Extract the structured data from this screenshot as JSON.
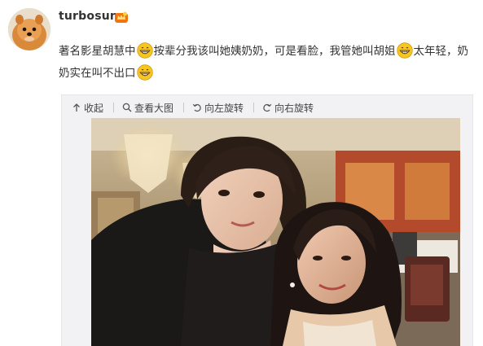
{
  "post": {
    "username": "turbosun",
    "text_segments": [
      {
        "type": "text",
        "value": "著名影星胡慧中"
      },
      {
        "type": "emoji",
        "icon": "grin-emoji-icon"
      },
      {
        "type": "text",
        "value": "按辈分我该叫她姨奶奶，可是看脸，我管她叫胡姐"
      },
      {
        "type": "emoji",
        "icon": "grin-emoji-icon"
      },
      {
        "type": "text",
        "value": "太年轻，奶奶实在叫不出口"
      },
      {
        "type": "emoji",
        "icon": "grin-emoji-icon"
      }
    ]
  },
  "media_toolbar": {
    "collapse": "收起",
    "view_large": "查看大图",
    "rotate_left": "向左旋转",
    "rotate_right": "向右旋转"
  },
  "icons": {
    "avatar": "pomeranian-dog-avatar",
    "vip": "vip-crown-badge-icon",
    "emoji": "grin-emoji-icon"
  },
  "colors": {
    "text": "#333333",
    "emoji_yellow": "#f7c623",
    "vip_orange": "#f0750f",
    "toolbar_bg": "#f2f2f5"
  }
}
